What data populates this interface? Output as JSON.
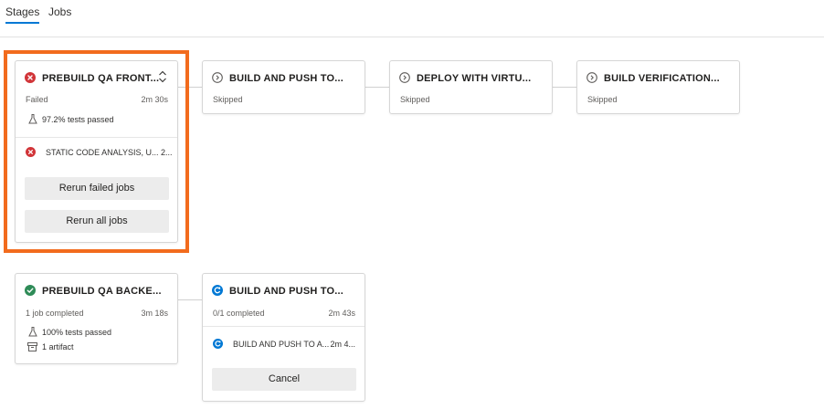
{
  "tabs": {
    "stages": "Stages",
    "jobs": "Jobs"
  },
  "colors": {
    "failed": "#d13438",
    "success": "#2e8b57",
    "running": "#0078d4",
    "skipped": "#605e5c",
    "highlight": "#f26b1d"
  },
  "stage1": {
    "title": "PREBUILD QA FRONT...",
    "status": "Failed",
    "duration": "2m 30s",
    "tests": "97.2% tests passed",
    "job_name": "STATIC CODE ANALYSIS, U... 2...",
    "rerun_failed": "Rerun failed jobs",
    "rerun_all": "Rerun all jobs"
  },
  "stage2": {
    "title": "BUILD AND PUSH TO...",
    "status": "Skipped"
  },
  "stage3": {
    "title": "DEPLOY WITH VIRTU...",
    "status": "Skipped"
  },
  "stage4": {
    "title": "BUILD VERIFICATION...",
    "status": "Skipped"
  },
  "stage5": {
    "title": "PREBUILD QA BACKE...",
    "status": "1 job completed",
    "duration": "3m 18s",
    "tests": "100% tests passed",
    "artifacts": "1 artifact"
  },
  "stage6": {
    "title": "BUILD AND PUSH TO...",
    "status": "0/1 completed",
    "duration": "2m 43s",
    "job_name": "BUILD AND PUSH TO A...",
    "job_duration": "2m 4...",
    "cancel": "Cancel"
  }
}
